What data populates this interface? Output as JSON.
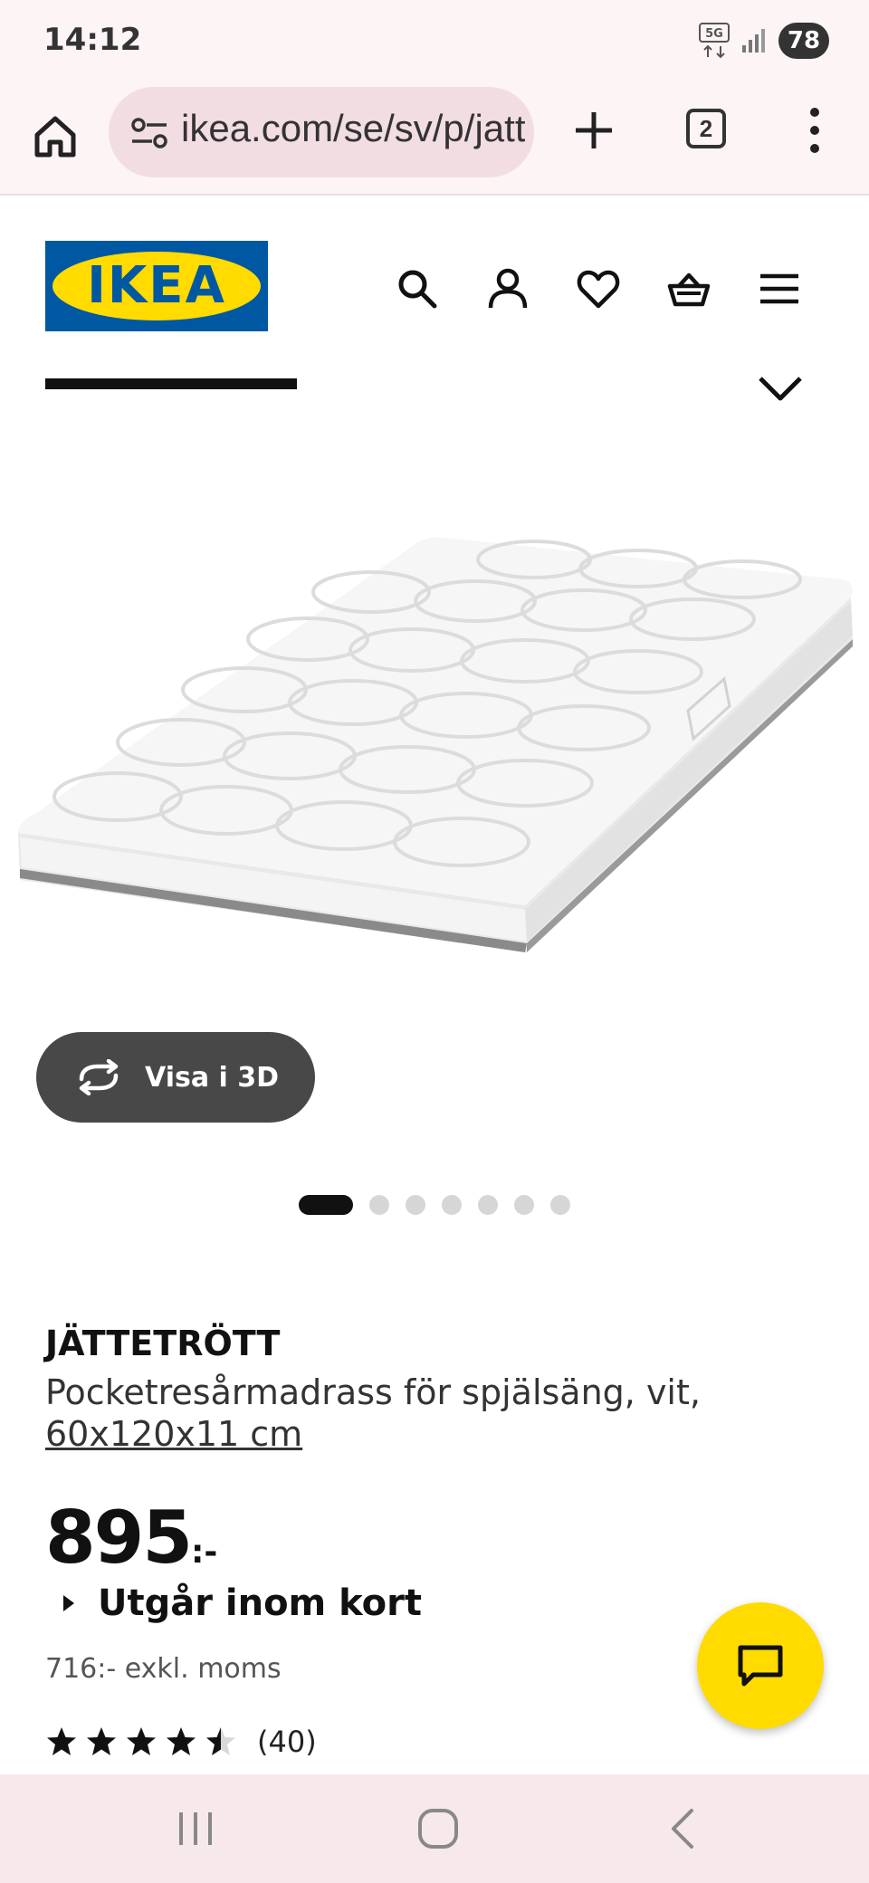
{
  "status_bar": {
    "time": "14:12",
    "network": "5G",
    "battery": "78"
  },
  "browser": {
    "url": "ikea.com/se/sv/p/jattetrott-pocketresarmadrass",
    "tab_count": "2"
  },
  "header": {
    "logo_text": "IKEA"
  },
  "gallery": {
    "view_3d_label": "Visa i 3D",
    "image_count": 7,
    "active_index": 0
  },
  "product": {
    "name": "JÄTTETRÖTT",
    "description": "Pocketresårmadrass för spjälsäng, vit,",
    "size": "60x120x11 cm",
    "price": "895",
    "price_suffix": ":-",
    "availability": "Utgår inom kort",
    "price_excl_vat": "716:- exkl. moms",
    "rating_value": 4.5,
    "rating_max": 5,
    "review_count": "(40)"
  },
  "colors": {
    "ikea_blue": "#0058a3",
    "ikea_yellow": "#ffdb00",
    "browser_bg": "#fdf4f5"
  }
}
